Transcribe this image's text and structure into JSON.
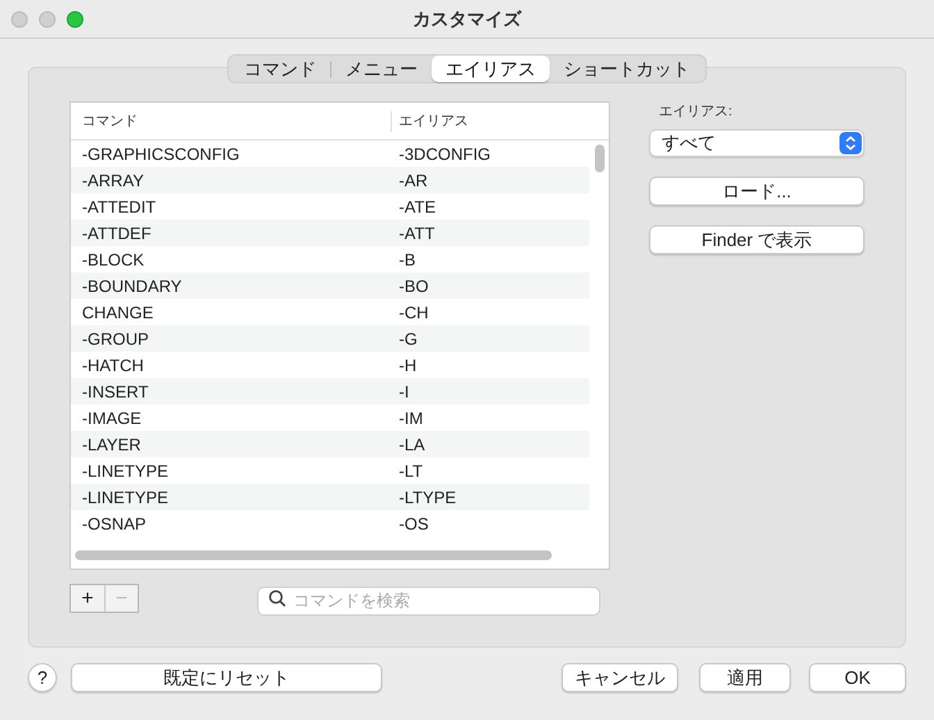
{
  "window": {
    "title": "カスタマイズ"
  },
  "tabs": [
    {
      "label": "コマンド",
      "selected": false
    },
    {
      "label": "メニュー",
      "selected": false
    },
    {
      "label": "エイリアス",
      "selected": true
    },
    {
      "label": "ショートカット",
      "selected": false
    }
  ],
  "table": {
    "columns": [
      "コマンド",
      "エイリアス"
    ],
    "rows": [
      [
        "-GRAPHICSCONFIG",
        "-3DCONFIG"
      ],
      [
        "-ARRAY",
        "-AR"
      ],
      [
        "-ATTEDIT",
        "-ATE"
      ],
      [
        "-ATTDEF",
        "-ATT"
      ],
      [
        "-BLOCK",
        "-B"
      ],
      [
        "-BOUNDARY",
        "-BO"
      ],
      [
        "CHANGE",
        "-CH"
      ],
      [
        "-GROUP",
        "-G"
      ],
      [
        "-HATCH",
        "-H"
      ],
      [
        "-INSERT",
        "-I"
      ],
      [
        "-IMAGE",
        "-IM"
      ],
      [
        "-LAYER",
        "-LA"
      ],
      [
        "-LINETYPE",
        "-LT"
      ],
      [
        "-LINETYPE",
        "-LTYPE"
      ],
      [
        "-OSNAP",
        "-OS"
      ]
    ]
  },
  "list_buttons": [
    {
      "label": "+",
      "disabled": false
    },
    {
      "label": "−",
      "disabled": true
    }
  ],
  "search": {
    "placeholder": "コマンドを検索"
  },
  "alias_filter": {
    "label": "エイリアス:",
    "value": "すべて"
  },
  "side_buttons": [
    "ロード...",
    "Finder で表示"
  ],
  "help_button": "?",
  "reset_button": "既定にリセット",
  "buttons": [
    "キャンセル",
    "適用",
    "OK"
  ]
}
